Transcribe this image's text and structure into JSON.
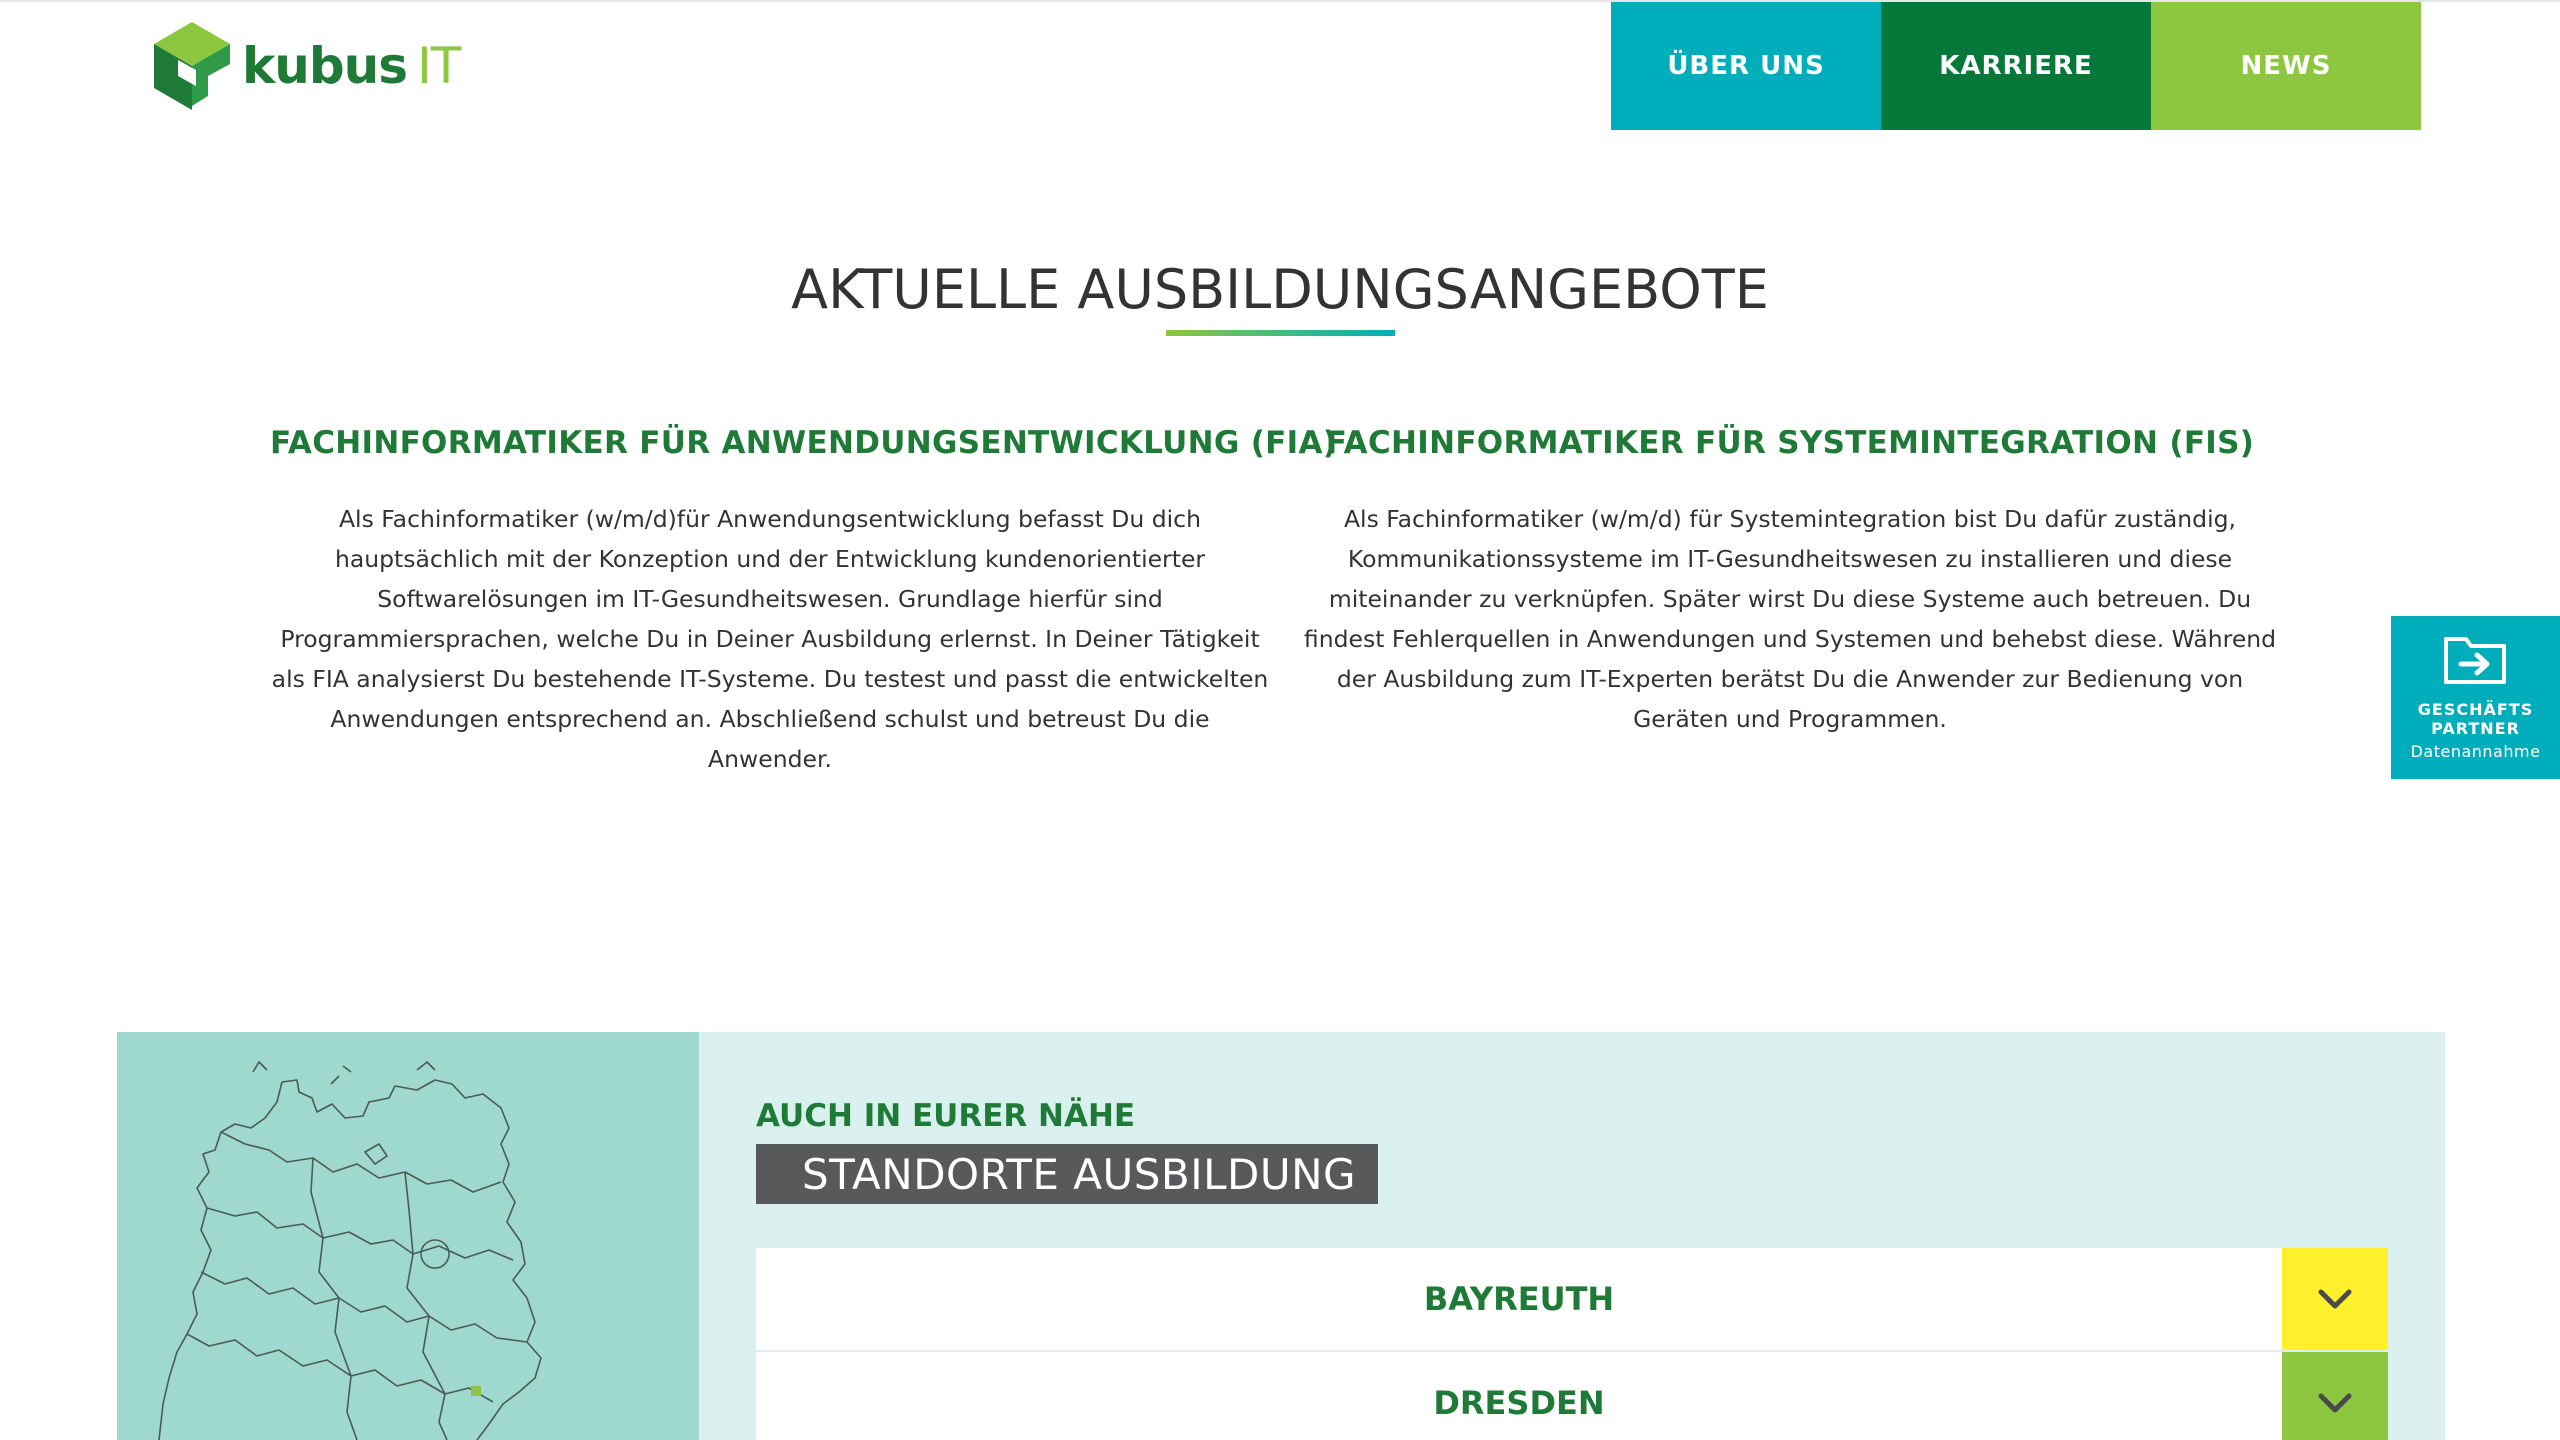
{
  "header": {
    "logo_word": "kubus",
    "logo_suffix": "IT",
    "nav": [
      {
        "label": "ÜBER UNS",
        "color": "#00aebb"
      },
      {
        "label": "KARRIERE",
        "color": "#05783a"
      },
      {
        "label": "NEWS",
        "color": "#8dc63f"
      }
    ]
  },
  "section": {
    "title": "AKTUELLE AUSBILDUNGSANGEBOTE",
    "columns": [
      {
        "title": "FACHINFORMATIKER FÜR ANWENDUNGSENTWICKLUNG (FIA)",
        "text": "Als Fachinformatiker (w/m/d)für Anwendungsentwicklung befasst Du dich hauptsächlich mit der Konzeption und der Entwicklung kundenorientierter Softwarelösungen im IT-Gesundheitswesen. Grundlage hierfür sind Programmiersprachen, welche Du in Deiner Ausbildung erlernst. In Deiner Tätigkeit als FIA analysierst Du bestehende IT-Systeme. Du testest und passt die entwickelten Anwendungen entsprechend an. Abschließend schulst und betreust Du die Anwender."
      },
      {
        "title": "FACHINFORMATIKER FÜR SYSTEMINTEGRATION (FIS)",
        "text": "Als Fachinformatiker (w/m/d) für Systemintegration bist Du dafür zuständig, Kommunikationssysteme im IT-Gesundheitswesen zu installieren und diese miteinander zu verknüpfen. Später wirst Du diese Systeme auch betreuen. Du findest Fehlerquellen in Anwendungen und Systemen und behebst diese. Während der Ausbildung zum IT-Experten berätst Du die Anwender zur Bedienung von Geräten und Programmen."
      }
    ]
  },
  "side_tab": {
    "icon": "folder-arrow-icon",
    "title_line1": "GESCHÄFTS",
    "title_line2": "PARTNER",
    "subtitle": "Datenannahme"
  },
  "locations": {
    "kicker": "AUCH IN EURER NÄHE",
    "heading": "STANDORTE AUSBILDUNG",
    "items": [
      {
        "label": "BAYREUTH",
        "toggle_color": "#fff02c"
      },
      {
        "label": "DRESDEN",
        "toggle_color": "#8dc63f"
      }
    ]
  }
}
